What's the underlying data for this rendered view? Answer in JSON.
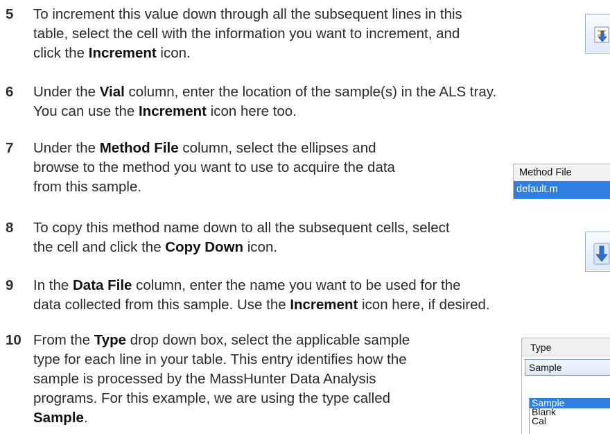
{
  "steps": [
    {
      "number": "5",
      "lines": [
        [
          "To increment this value down through all the subsequent lines in this"
        ],
        [
          "table, select the cell with the information you want to increment, and"
        ],
        [
          "click the ",
          "**Increment",
          " icon."
        ]
      ]
    },
    {
      "number": "6",
      "lines": [
        [
          "Under the ",
          "**Vial",
          " column, enter the location of the sample(s) in the ALS tray."
        ],
        [
          "You can use the ",
          "**Increment",
          " icon here too."
        ]
      ]
    },
    {
      "number": "7",
      "lines": [
        [
          "Under the ",
          "**Method File",
          " column, select the ellipses and"
        ],
        [
          "browse to the method you want to use to acquire the data"
        ],
        [
          "from this sample."
        ]
      ]
    },
    {
      "number": "8",
      "lines": [
        [
          "To copy this method name down to all the subsequent cells, select"
        ],
        [
          "the cell and click the ",
          "**Copy Down",
          " icon."
        ]
      ]
    },
    {
      "number": "9",
      "lines": [
        [
          "In the ",
          "**Data File",
          " column, enter the name you want to be used for the"
        ],
        [
          "data collected from this sample. Use the ",
          "**Increment",
          " icon here, if desired."
        ]
      ]
    },
    {
      "number": "10",
      "lines": [
        [
          "From the ",
          "**Type",
          " drop down box, select the applicable sample"
        ],
        [
          "type for each line in your table. This entry identifies how the"
        ],
        [
          "sample is processed by the MassHunter Data Analysis"
        ],
        [
          "programs. For this example, we are using the type called"
        ],
        [
          "**Sample",
          "."
        ]
      ]
    }
  ],
  "method_file_thumb": {
    "header": "Method File",
    "value": "default.m"
  },
  "type_thumb": {
    "header": "Type",
    "selected": "Sample",
    "options": [
      "Sample",
      "Blank",
      "Cal"
    ],
    "highlighted_option": "Sample"
  },
  "icons": {
    "increment": "increment-icon",
    "copy_down": "copy-down-icon"
  },
  "colors": {
    "selection": "#2f7fe0",
    "icon_blue": "#2e6fd0",
    "icon_yellow": "#f2c230"
  }
}
